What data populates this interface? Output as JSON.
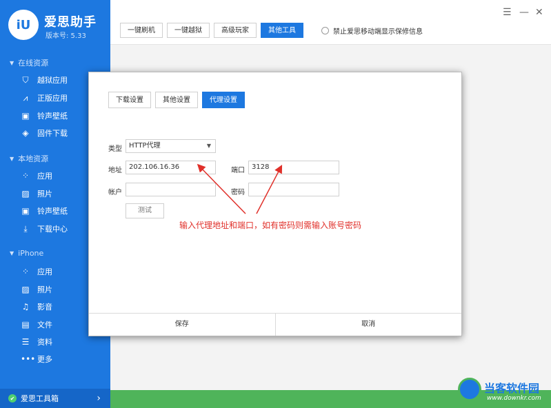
{
  "app": {
    "logo_text": "iU",
    "name": "爱思助手",
    "version": "版本号: 5.33"
  },
  "sidebar": {
    "sections": [
      {
        "title": "在线资源",
        "items": [
          {
            "label": "越狱应用",
            "icon": "shield-icon"
          },
          {
            "label": "正版应用",
            "icon": "appstore-icon"
          },
          {
            "label": "铃声壁纸",
            "icon": "film-icon"
          },
          {
            "label": "固件下载",
            "icon": "box-icon"
          }
        ]
      },
      {
        "title": "本地资源",
        "items": [
          {
            "label": "应用",
            "icon": "apps-grid-icon"
          },
          {
            "label": "照片",
            "icon": "photo-icon"
          },
          {
            "label": "铃声壁纸",
            "icon": "film-icon"
          },
          {
            "label": "下载中心",
            "icon": "download-icon"
          }
        ]
      },
      {
        "title": "iPhone",
        "items": [
          {
            "label": "应用",
            "icon": "apps-grid-icon"
          },
          {
            "label": "照片",
            "icon": "photo-icon"
          },
          {
            "label": "影音",
            "icon": "media-icon"
          },
          {
            "label": "文件",
            "icon": "file-icon"
          },
          {
            "label": "资料",
            "icon": "list-icon"
          },
          {
            "label": "更多",
            "icon": "more-icon"
          }
        ]
      }
    ],
    "bottom_label": "爱思工具箱"
  },
  "toolbar": {
    "buttons": [
      "一键刷机",
      "一键越狱",
      "高级玩家",
      "其他工具"
    ],
    "active_button": "其他工具",
    "checkbox_label": "禁止爱思移动端显示保修信息"
  },
  "dialog": {
    "tabs": [
      "下载设置",
      "其他设置",
      "代理设置"
    ],
    "active_tab": "代理设置",
    "type_label": "类型",
    "type_value": "HTTP代理",
    "address_label": "地址",
    "address_value": "202.106.16.36",
    "port_label": "端口",
    "port_value": "3128",
    "account_label": "帐户",
    "account_value": "",
    "password_label": "密码",
    "password_value": "",
    "test_button": "测试",
    "annotation": "输入代理地址和端口，如有密码则需输入账号密码",
    "save_button": "保存",
    "cancel_button": "取消"
  },
  "watermark": {
    "title": "当客软件园",
    "url": "www.downkr.com"
  },
  "colors": {
    "accent": "#1d78e0",
    "annotation": "#e0302a",
    "strip": "#4fb45a"
  }
}
